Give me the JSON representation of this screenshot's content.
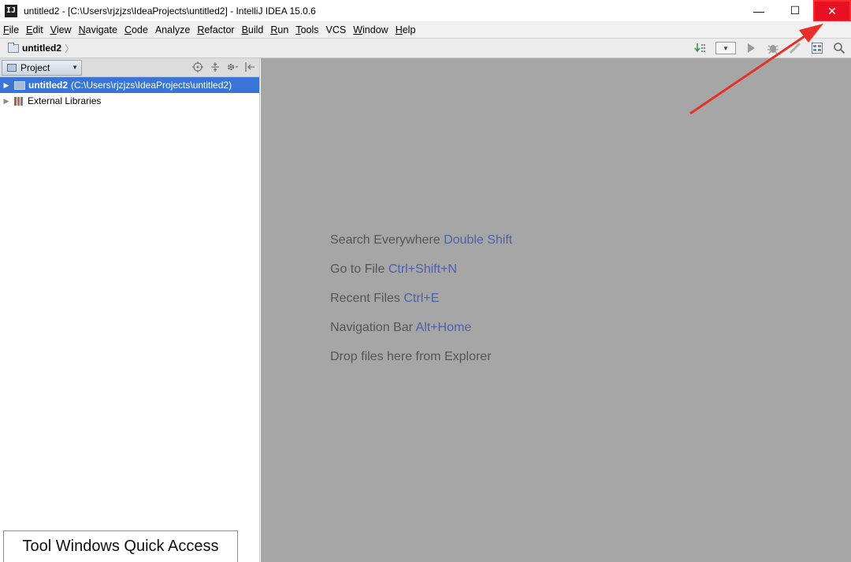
{
  "window": {
    "title": "untitled2 - [C:\\Users\\rjzjzs\\IdeaProjects\\untitled2] - IntelliJ IDEA 15.0.6",
    "app_icon": "IJ",
    "minimize": "—",
    "maximize": "☐",
    "close": "✕"
  },
  "menu": [
    {
      "mnemonic": "F",
      "rest": "ile"
    },
    {
      "mnemonic": "E",
      "rest": "dit"
    },
    {
      "mnemonic": "V",
      "rest": "iew"
    },
    {
      "mnemonic": "N",
      "rest": "avigate"
    },
    {
      "mnemonic": "C",
      "rest": "ode"
    },
    {
      "mnemonic": "",
      "rest": "Analyze"
    },
    {
      "mnemonic": "R",
      "rest": "efactor"
    },
    {
      "mnemonic": "B",
      "rest": "uild"
    },
    {
      "mnemonic": "R",
      "rest": "un"
    },
    {
      "mnemonic": "T",
      "rest": "ools"
    },
    {
      "mnemonic": "",
      "rest": "VCS"
    },
    {
      "mnemonic": "W",
      "rest": "indow"
    },
    {
      "mnemonic": "H",
      "rest": "elp"
    }
  ],
  "navbar": {
    "breadcrumb": "untitled2",
    "separator": "〉",
    "icons": [
      "vcs-update-icon",
      "run-config-combo",
      "run-icon",
      "debug-icon",
      "coverage-icon",
      "project-structure-icon",
      "search-icon"
    ]
  },
  "project_panel": {
    "view_selector": "Project",
    "tree": [
      {
        "name": "untitled2",
        "path": "(C:\\Users\\rjzjzs\\IdeaProjects\\untitled2)",
        "selected": true
      },
      {
        "name": "External Libraries",
        "path": "",
        "selected": false
      }
    ]
  },
  "editor_hints": [
    {
      "text": "Search Everywhere",
      "key": "Double Shift"
    },
    {
      "text": "Go to File",
      "key": "Ctrl+Shift+N"
    },
    {
      "text": "Recent Files",
      "key": "Ctrl+E"
    },
    {
      "text": "Navigation Bar",
      "key": "Alt+Home"
    },
    {
      "text": "Drop files here from Explorer",
      "key": ""
    }
  ],
  "tooltip": {
    "text": "Tool Windows Quick Access"
  },
  "colors": {
    "selection": "#3875d7",
    "editor_bg": "#a6a6a6",
    "hint_key": "#5060a8",
    "close_red": "#e81123",
    "annotation_red": "#e8302a"
  }
}
